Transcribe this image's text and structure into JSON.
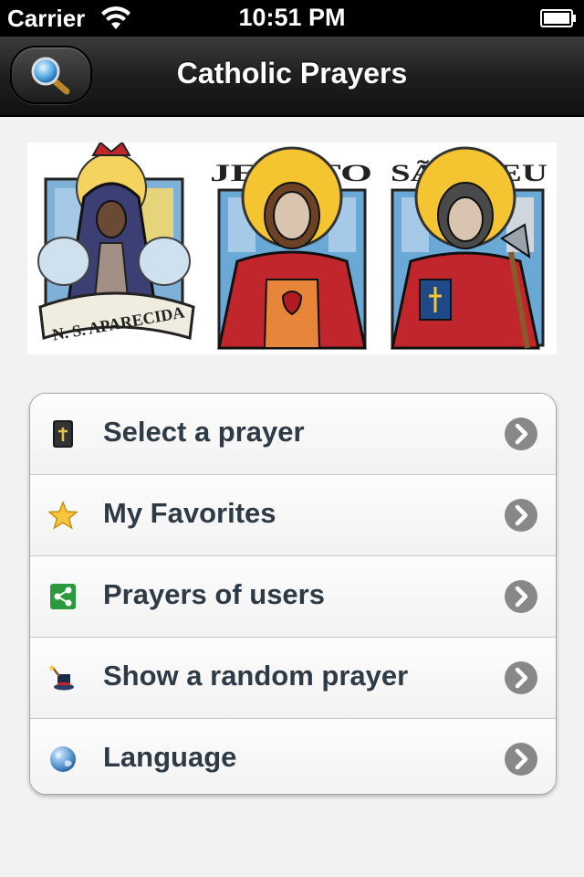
{
  "status_bar": {
    "carrier": "Carrier",
    "time": "10:51 PM"
  },
  "nav": {
    "title": "Catholic Prayers",
    "search_icon": "search-icon"
  },
  "banner": {
    "panels": [
      {
        "caption": "N. S. APARECIDA",
        "header": ""
      },
      {
        "caption": "",
        "header": "JES STO"
      },
      {
        "caption": "",
        "header": "SÃO DEU"
      }
    ]
  },
  "menu": {
    "items": [
      {
        "label": "Select a prayer",
        "icon": "bible-icon"
      },
      {
        "label": "My Favorites",
        "icon": "star-icon"
      },
      {
        "label": "Prayers of users",
        "icon": "share-icon"
      },
      {
        "label": "Show a random prayer",
        "icon": "magic-hat-icon"
      },
      {
        "label": "Language",
        "icon": "globe-icon"
      }
    ]
  },
  "colors": {
    "nav_bg": "#1f1f1f",
    "label": "#2e3a46",
    "chevron": "#888888"
  }
}
